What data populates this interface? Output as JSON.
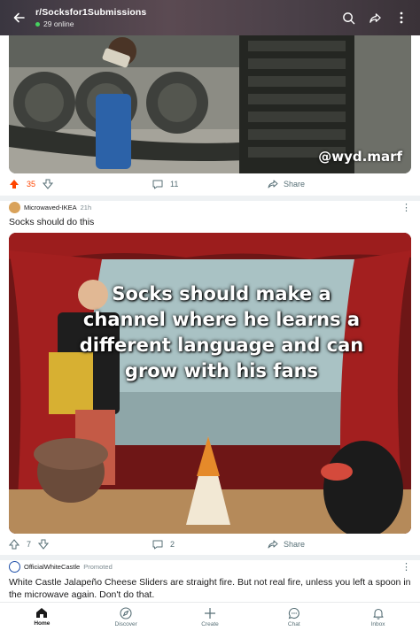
{
  "header": {
    "subreddit": "r/Socksfor1Submissions",
    "online": "29 online"
  },
  "post1": {
    "watermark": "@wyd.marf",
    "upvotes": "35",
    "comments": "11",
    "share_label": "Share",
    "upvote_color": "#ff4500"
  },
  "post2": {
    "username": "Microwaved-IKEA",
    "time": "21h",
    "title": "Socks should do this",
    "meme_text": "Socks should make a channel where he learns a different language and can grow with his fans",
    "upvotes": "7",
    "comments": "2",
    "share_label": "Share"
  },
  "post3": {
    "username": "OfficialWhiteCastle",
    "promoted": "Promoted",
    "title": "White Castle Jalapeño Cheese Sliders are straight fire. But not real fire, unless you left a spoon in the microwave again. Don't do that."
  },
  "nav": {
    "home": "Home",
    "discover": "Discover",
    "create": "Create",
    "chat": "Chat",
    "inbox": "Inbox"
  }
}
